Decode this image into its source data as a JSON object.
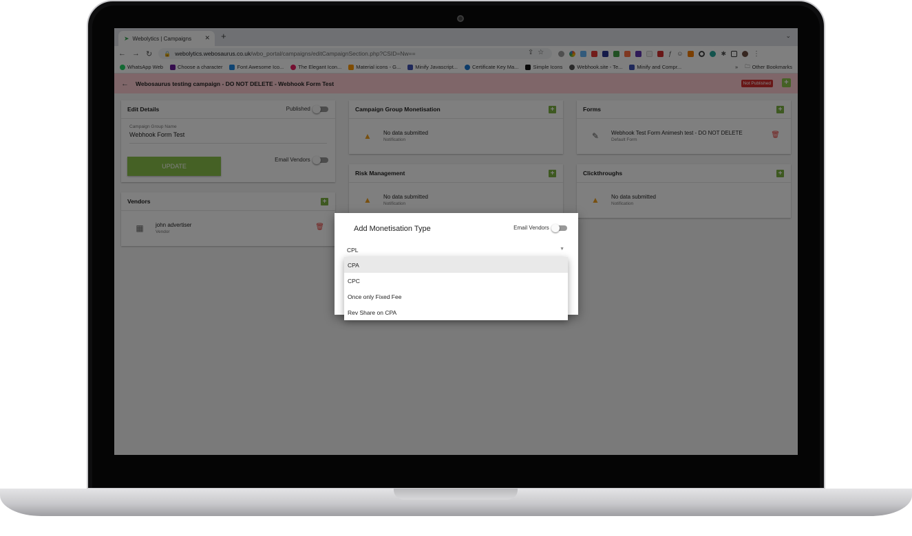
{
  "browser": {
    "tab_title": "Webolytics | Campaigns",
    "url_host": "webolytics.webosaurus.co.uk",
    "url_path": "/wbo_portal/campaigns/editCampaignSection.php?CSID=Nw==",
    "bookmarks": [
      {
        "label": "WhatsApp Web",
        "color": "#25d366"
      },
      {
        "label": "Choose a character",
        "color": "#6a1b9a"
      },
      {
        "label": "Font Awesome Ico...",
        "color": "#1e88e5"
      },
      {
        "label": "The Elegant Icon...",
        "color": "#e91e63"
      },
      {
        "label": "Material icons - G...",
        "color": "#ff9800"
      },
      {
        "label": "Minify Javascript...",
        "color": "#3f51b5"
      },
      {
        "label": "Certificate Key Ma...",
        "color": "#1976d2"
      },
      {
        "label": "Simple Icons",
        "color": "#111111"
      },
      {
        "label": "Webhook.site - Te...",
        "color": "#555555"
      },
      {
        "label": "Minify and Compr...",
        "color": "#3f51b5"
      }
    ],
    "bookmarks_more": "»",
    "other_bookmarks": "Other Bookmarks"
  },
  "header": {
    "title": "Webosaurus testing campaign - DO NOT DELETE - Webhook Form Test",
    "status_badge": "Not Published"
  },
  "edit_details": {
    "title": "Edit Details",
    "published_label": "Published",
    "field_label": "Campaign Group Name",
    "field_value": "Webhook Form Test",
    "update_label": "UPDATE",
    "email_vendors_label": "Email Vendors"
  },
  "vendors": {
    "title": "Vendors",
    "items": [
      {
        "name": "john advertiser",
        "sub": "Vendor"
      }
    ]
  },
  "monetisation": {
    "title": "Campaign Group Monetisation",
    "empty": "No data submitted",
    "sub": "Notification"
  },
  "risk": {
    "title": "Risk Management",
    "empty": "No data submitted",
    "sub": "Notification"
  },
  "forms": {
    "title": "Forms",
    "items": [
      {
        "name": "Webhook Test Form Animesh test - DO NOT DELETE",
        "sub": "Default Form"
      }
    ]
  },
  "clickthroughs": {
    "title": "Clickthroughs",
    "empty": "No data submitted",
    "sub": "Notification"
  },
  "dialog": {
    "title": "Add Monetisation Type",
    "email_vendors_label": "Email Vendors",
    "selected": "CPL",
    "options": [
      "CPA",
      "CPC",
      "Once only Fixed Fee",
      "Rev Share on CPA"
    ],
    "highlighted_option": "CPA"
  },
  "colors": {
    "accent_green": "#8bc34a",
    "header_pink": "#ffcdd2",
    "danger_red": "#d32f2f",
    "warning_orange": "#f0a020"
  }
}
